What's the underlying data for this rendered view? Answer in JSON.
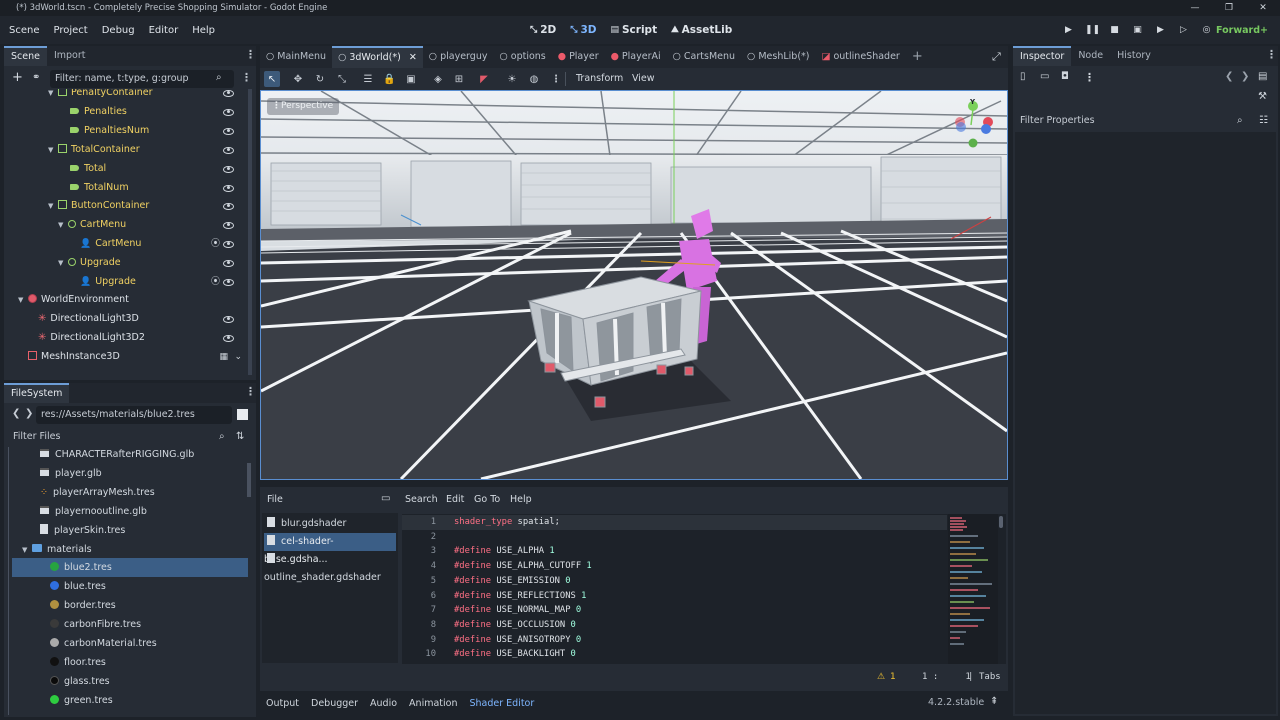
{
  "window": {
    "title": "(*) 3dWorld.tscn - Completely Precise Shopping Simulator - Godot Engine",
    "controls": [
      "—",
      "❐",
      "✕"
    ]
  },
  "menu": [
    "Scene",
    "Project",
    "Debug",
    "Editor",
    "Help"
  ],
  "main_screens": [
    {
      "label": "2D",
      "icon": "2d-icon"
    },
    {
      "label": "3D",
      "icon": "3d-icon"
    },
    {
      "label": "Script",
      "icon": "script-icon"
    },
    {
      "label": "AssetLib",
      "icon": "assetlib-icon"
    }
  ],
  "active_main_screen": "3D",
  "renderer": "Forward+",
  "scene_dock": {
    "tabs": [
      "Scene",
      "Import"
    ],
    "filter_placeholder": "Filter: name, t:type, g:group",
    "tree": [
      {
        "name": "PenaltyContainer",
        "icon": "container"
      },
      {
        "name": "Penalties",
        "icon": "label"
      },
      {
        "name": "PenaltiesNum",
        "icon": "label"
      },
      {
        "name": "TotalContainer",
        "icon": "container"
      },
      {
        "name": "Total",
        "icon": "label"
      },
      {
        "name": "TotalNum",
        "icon": "label"
      },
      {
        "name": "ButtonContainer",
        "icon": "container"
      },
      {
        "name": "CartMenu",
        "icon": "circle"
      },
      {
        "name": "CartMenu",
        "icon": "person"
      },
      {
        "name": "Upgrade",
        "icon": "circle"
      },
      {
        "name": "Upgrade",
        "icon": "person"
      },
      {
        "name": "WorldEnvironment",
        "icon": "world"
      },
      {
        "name": "DirectionalLight3D",
        "icon": "light"
      },
      {
        "name": "DirectionalLight3D2",
        "icon": "light"
      },
      {
        "name": "MeshInstance3D",
        "icon": "mesh"
      }
    ]
  },
  "filesystem": {
    "tab": "FileSystem",
    "path": "res://Assets/materials/blue2.tres",
    "filter_placeholder": "Filter Files",
    "items": [
      {
        "name": "CHARACTERafterRIGGING.glb",
        "icon": "scene",
        "color": "#d8dde3"
      },
      {
        "name": "player.glb",
        "icon": "scene",
        "color": "#d8dde3"
      },
      {
        "name": "playerArrayMesh.tres",
        "icon": "mesh",
        "color": "#f0a030"
      },
      {
        "name": "playernooutline.glb",
        "icon": "scene",
        "color": "#d8dde3"
      },
      {
        "name": "playerSkin.tres",
        "icon": "file",
        "color": "#d8dde3"
      },
      {
        "name": "materials",
        "icon": "folder",
        "color": "#5fa0e0"
      },
      {
        "name": "blue2.tres",
        "icon": "material",
        "color": "#27a340",
        "selected": true
      },
      {
        "name": "blue.tres",
        "icon": "material",
        "color": "#2f6fe0"
      },
      {
        "name": "border.tres",
        "icon": "material",
        "color": "#b09040"
      },
      {
        "name": "carbonFibre.tres",
        "icon": "material",
        "color": "#3a3a3a"
      },
      {
        "name": "carbonMaterial.tres",
        "icon": "material",
        "color": "#aaaaaa"
      },
      {
        "name": "floor.tres",
        "icon": "material",
        "color": "#111111"
      },
      {
        "name": "glass.tres",
        "icon": "material",
        "color": "#0b0b0b"
      },
      {
        "name": "green.tres",
        "icon": "material",
        "color": "#2ecc40"
      }
    ]
  },
  "editor_tabs": [
    {
      "label": "MainMenu",
      "icon": "circle"
    },
    {
      "label": "3dWorld(*)",
      "icon": "circle",
      "active": true
    },
    {
      "label": "playerguy",
      "icon": "circle"
    },
    {
      "label": "options",
      "icon": "circle"
    },
    {
      "label": "Player",
      "icon": "red"
    },
    {
      "label": "PlayerAi",
      "icon": "red"
    },
    {
      "label": "CartsMenu",
      "icon": "circle"
    },
    {
      "label": "MeshLib(*)",
      "icon": "circle"
    },
    {
      "label": "outlineShader",
      "icon": "shader"
    }
  ],
  "viewport": {
    "toolbar_menus": [
      "Transform",
      "View"
    ],
    "perspective_label": "Perspective",
    "gizmo_y": "Y"
  },
  "shader_editor": {
    "file_menu": "File",
    "menus": [
      "Search",
      "Edit",
      "Go To",
      "Help"
    ],
    "files": [
      "blur.gdshader",
      "cel-shader-base.gdsha...",
      "outline_shader.gdshader"
    ],
    "selected_file_index": 1,
    "lines": [
      {
        "n": "1",
        "kw": "shader_type",
        "rest": " spatial;",
        "val": ""
      },
      {
        "n": "2",
        "kw": "",
        "rest": "",
        "val": ""
      },
      {
        "n": "3",
        "kw": "#define",
        "rest": " USE_ALPHA ",
        "val": "1"
      },
      {
        "n": "4",
        "kw": "#define",
        "rest": " USE_ALPHA_CUTOFF ",
        "val": "1"
      },
      {
        "n": "5",
        "kw": "#define",
        "rest": " USE_EMISSION ",
        "val": "0"
      },
      {
        "n": "6",
        "kw": "#define",
        "rest": " USE_REFLECTIONS ",
        "val": "1"
      },
      {
        "n": "7",
        "kw": "#define",
        "rest": " USE_NORMAL_MAP ",
        "val": "0"
      },
      {
        "n": "8",
        "kw": "#define",
        "rest": " USE_OCCLUSION ",
        "val": "0"
      },
      {
        "n": "9",
        "kw": "#define",
        "rest": " USE_ANISOTROPY ",
        "val": "0"
      },
      {
        "n": "10",
        "kw": "#define",
        "rest": " USE_BACKLIGHT ",
        "val": "0"
      }
    ],
    "warnings": "1",
    "cursor": "1 :     1",
    "indent": "Tabs"
  },
  "inspector": {
    "tabs": [
      "Inspector",
      "Node",
      "History"
    ],
    "filter_placeholder": "Filter Properties"
  },
  "bottom_tabs": [
    "Output",
    "Debugger",
    "Audio",
    "Animation",
    "Shader Editor"
  ],
  "active_bottom_tab": "Shader Editor",
  "version": "4.2.2.stable"
}
